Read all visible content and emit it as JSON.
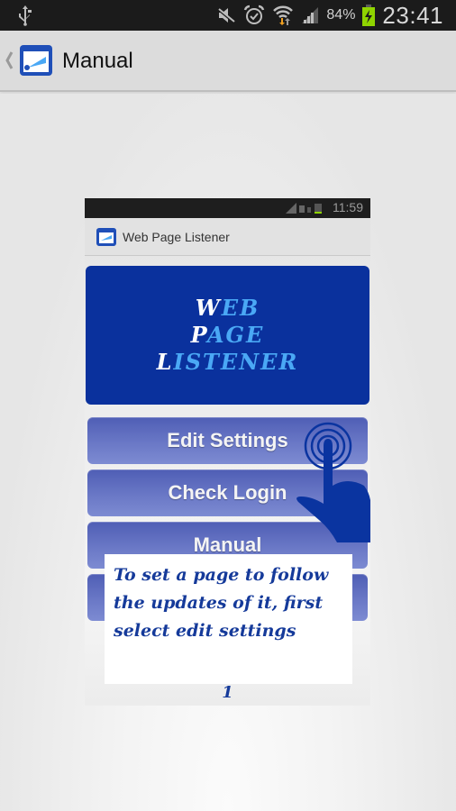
{
  "status_bar": {
    "battery_percent": "84%",
    "time": "23:41",
    "icons": [
      "usb-icon",
      "mute-icon",
      "alarm-icon",
      "wifi-icon",
      "signal-icon",
      "battery-charging-icon"
    ],
    "battery_color": "#8fd400"
  },
  "action_bar": {
    "title": "Manual",
    "back_icon": "chevron-left-icon",
    "app_icon": "web-page-listener-icon"
  },
  "manual_page": {
    "embedded_screen": {
      "status_time": "11:59",
      "app_title": "Web Page Listener",
      "banner_lines": [
        {
          "cap": "W",
          "rest": "EB"
        },
        {
          "cap": "P",
          "rest": "AGE"
        },
        {
          "cap": "L",
          "rest": "ISTENER"
        }
      ],
      "buttons": [
        "Edit Settings",
        "Check Login",
        "Manual",
        ""
      ],
      "pointer_icon": "tap-hand-icon"
    },
    "instruction_text": "To set a page to follow the updates of it, first select edit settings",
    "page_number": "1"
  },
  "colors": {
    "banner_bg": "#0a319d",
    "banner_text": "#4aa8f5",
    "button_gradient": [
      "#4f5eb5",
      "#7d8bd2"
    ],
    "hand": "#0a34a0",
    "instruction_text": "#153a9a"
  }
}
